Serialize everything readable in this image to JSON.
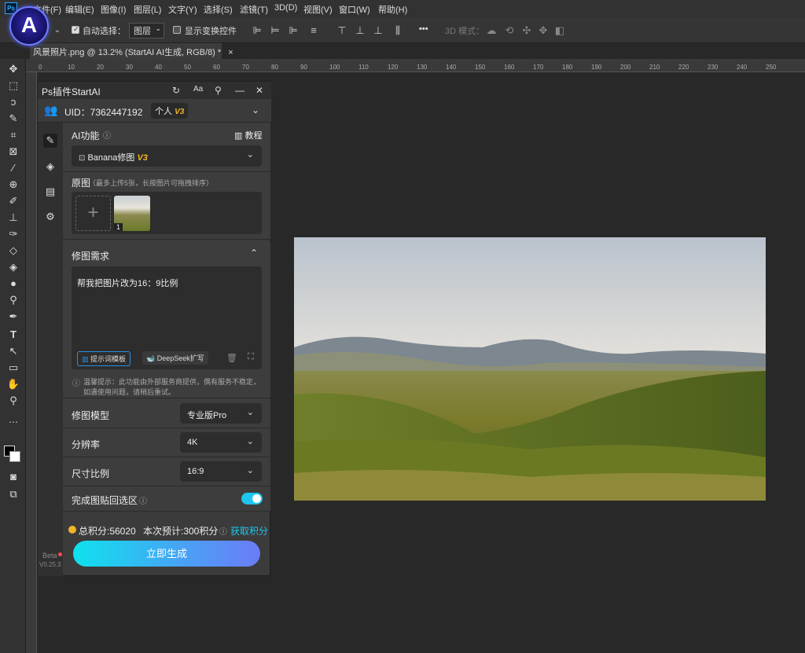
{
  "menubar": {
    "logo": "Ps",
    "items": [
      "文件(F)",
      "编辑(E)",
      "图像(I)",
      "图层(L)",
      "文字(Y)",
      "选择(S)",
      "滤镜(T)",
      "3D(D)",
      "视图(V)",
      "窗口(W)",
      "帮助(H)"
    ]
  },
  "options": {
    "auto_select_label": "自动选择：",
    "auto_select_value": "图层",
    "show_transform_label": "显示变换控件",
    "mode_3d_label": "3D 模式：",
    "more": "•••"
  },
  "startai_logo": "A",
  "document": {
    "tab_title": "风景照片.png @ 13.2% (StartAI AI生成, RGB/8) *",
    "close": "×"
  },
  "ruler": {
    "marks": [
      "0",
      "10",
      "20",
      "30",
      "40",
      "50",
      "60",
      "70",
      "80",
      "90",
      "100",
      "110",
      "120",
      "130",
      "140",
      "150",
      "160",
      "170",
      "180",
      "190",
      "200",
      "210",
      "220",
      "230",
      "240",
      "250"
    ]
  },
  "panel": {
    "title": "Ps插件StartAI",
    "uid_label": "UID：7362447192",
    "plan_badge": "个人",
    "plan_version": "V3",
    "ai_function_label": "AI功能",
    "tutorial_label": "教程",
    "function_value": "Banana修图",
    "function_version": "V3",
    "source_label": "原图",
    "source_hint": "（最多上传5张，长按图片可拖拽排序）",
    "thumb_index": "1",
    "request_label": "修图需求",
    "request_text": "帮我把图片改为16：9比例",
    "template_btn": "提示词模板",
    "deepseek_btn": "DeepSeek扩写",
    "notice_line1": "温馨提示：此功能由外部服务商提供，偶有服务不稳定，",
    "notice_line2": "如遇使用问题，请稍后重试。",
    "model_label": "修图模型",
    "model_value": "专业版Pro",
    "resolution_label": "分辨率",
    "resolution_value": "4K",
    "ratio_label": "尺寸比例",
    "ratio_value": "16:9",
    "paste_back_label": "完成图贴回选区",
    "paste_back_on": true,
    "total_points": "总积分:56020",
    "estimate": "本次预计:300积分",
    "get_points": "获取积分",
    "generate_btn": "立即生成",
    "beta": "Beta",
    "version": "V0.25.3"
  },
  "colors": {
    "accent": "#1cc6ef",
    "version_gold": "#f0b429",
    "link": "#1cc6ef"
  }
}
